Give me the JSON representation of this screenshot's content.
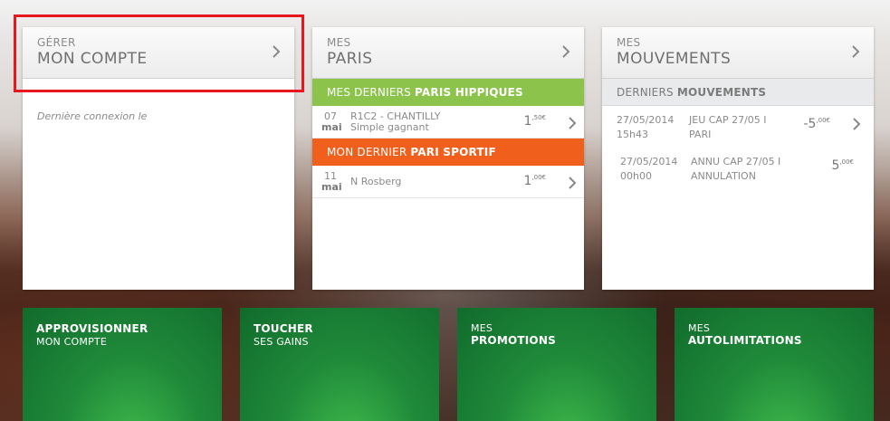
{
  "account": {
    "sup": "GÉRER",
    "title": "MON COMPTE",
    "last_connection": "Dernière connexion le"
  },
  "bets": {
    "sup": "MES",
    "title": "PARIS",
    "horse_band_prefix": "MES DERNIERS ",
    "horse_band_strong": "PARIS HIPPIQUES",
    "horse_bets": [
      {
        "day": "07",
        "month": "mai",
        "line1": "R1C2 - CHANTILLY",
        "line2": "Simple gagnant",
        "amount": "1",
        "cents": ",50€"
      }
    ],
    "sport_band_prefix": "MON DERNIER ",
    "sport_band_strong": "PARI SPORTIF",
    "sport_bets": [
      {
        "day": "11",
        "month": "mai",
        "line1": "N Rosberg",
        "amount": "1",
        "cents": ",00€"
      }
    ]
  },
  "movements": {
    "sup": "MES",
    "title": "MOUVEMENTS",
    "band_prefix": "DERNIERS ",
    "band_strong": "MOUVEMENTS",
    "rows": [
      {
        "date": "27/05/2014",
        "time": "15h43",
        "label": "JEU CAP 27/05 I",
        "type": "PARI",
        "amount": "-5",
        "cents": ",00€"
      },
      {
        "date": "27/05/2014",
        "time": "00h00",
        "label": "ANNU CAP 27/05 I",
        "type": "ANNULATION",
        "amount": "5",
        "cents": ",00€"
      }
    ]
  },
  "tiles": [
    {
      "main": "APPROVISIONNER",
      "sub": "MON COMPTE"
    },
    {
      "main": "TOUCHER",
      "sub": "SES GAINS"
    },
    {
      "sup": "MES",
      "main": "PROMOTIONS"
    },
    {
      "sup": "MES",
      "main": "AUTOLIMITATIONS"
    }
  ],
  "colors": {
    "highlight": "#e8171e",
    "horse_band": "#8cc34b",
    "sport_band": "#f0601c",
    "tile_green": "#1f8a3a"
  }
}
